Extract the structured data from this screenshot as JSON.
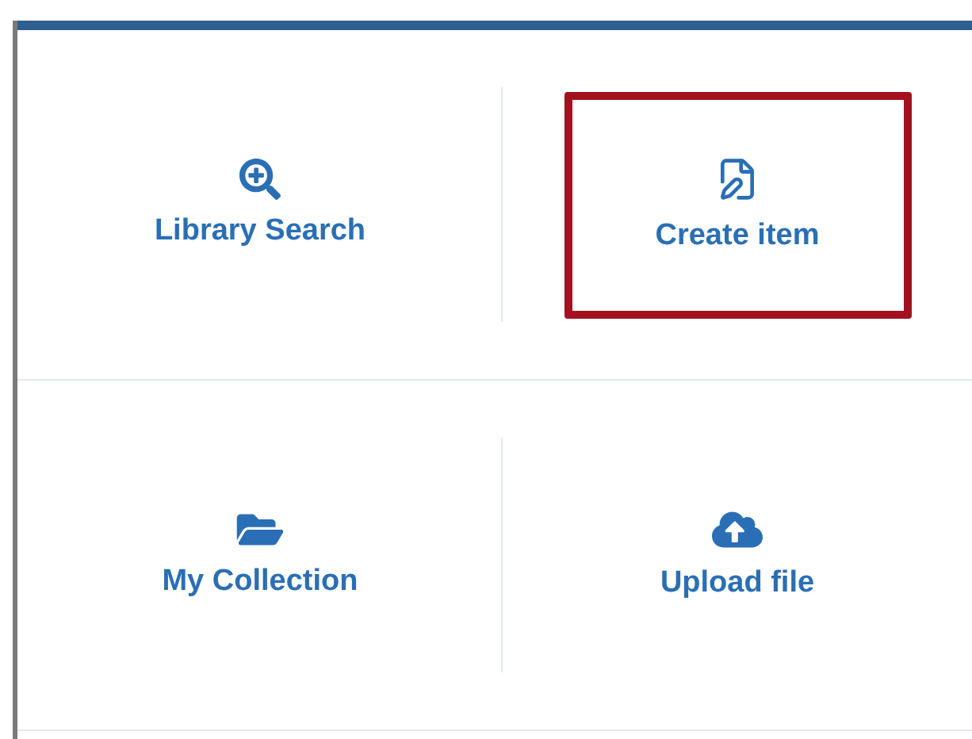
{
  "tiles": [
    {
      "kind": "search",
      "label": "Library Search",
      "highlighted": false
    },
    {
      "kind": "create",
      "label": "Create item",
      "highlighted": true
    },
    {
      "kind": "collection",
      "label": "My Collection",
      "highlighted": false
    },
    {
      "kind": "upload",
      "label": "Upload file",
      "highlighted": false
    }
  ]
}
